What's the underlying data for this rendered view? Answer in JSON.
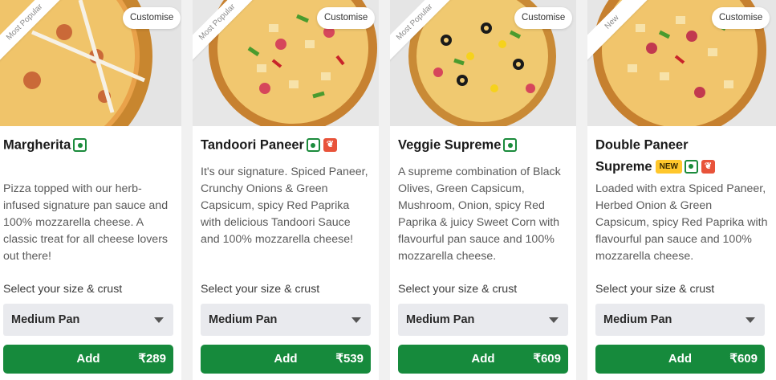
{
  "menu": {
    "size_label": "Select your size & crust",
    "customise_label": "Customise",
    "add_label": "Add",
    "colors": {
      "add_button": "#168a3c",
      "veg_mark": "#1b8b3c",
      "spicy_mark": "#e8533a",
      "new_badge": "#ffc72c"
    },
    "items": [
      {
        "ribbon": "Most Popular",
        "name": "Margherita",
        "name_line2": "",
        "new_badge": "",
        "veg": true,
        "spicy": false,
        "description": "Pizza topped with our herb-infused signature pan sauce and 100% mozzarella cheese. A classic treat for all cheese lovers out there!",
        "size_crust": "Medium Pan",
        "price": "₹289"
      },
      {
        "ribbon": "Most Popular",
        "name": "Tandoori Paneer",
        "name_line2": "",
        "new_badge": "",
        "veg": true,
        "spicy": true,
        "description": "It's our signature. Spiced Paneer, Crunchy Onions & Green Capsicum, spicy Red Paprika with delicious Tandoori Sauce and 100% mozzarella cheese!",
        "size_crust": "Medium Pan",
        "price": "₹539"
      },
      {
        "ribbon": "Most Popular",
        "name": "Veggie Supreme",
        "name_line2": "",
        "new_badge": "",
        "veg": true,
        "spicy": false,
        "description": "A supreme combination of Black Olives, Green Capsicum, Mushroom, Onion, spicy Red Paprika & juicy Sweet Corn with flavourful pan sauce and 100% mozzarella cheese.",
        "size_crust": "Medium Pan",
        "price": "₹609"
      },
      {
        "ribbon": "New",
        "name": "Double Paneer",
        "name_line2": "Supreme",
        "new_badge": "NEW",
        "veg": true,
        "spicy": true,
        "description": "Loaded with extra Spiced Paneer, Herbed Onion & Green Capsicum, spicy Red Paprika with flavourful pan sauce and 100% mozzarella cheese.",
        "size_crust": "Medium Pan",
        "price": "₹609"
      }
    ]
  }
}
